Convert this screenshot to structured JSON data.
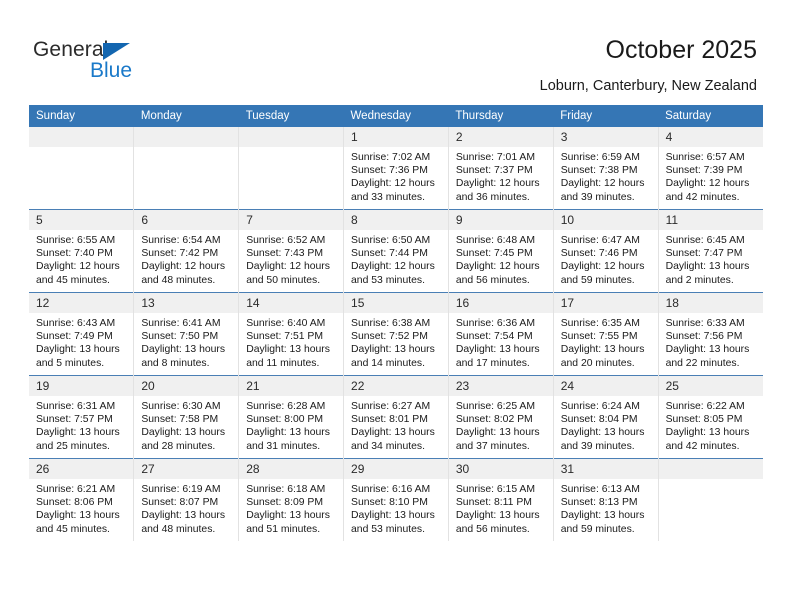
{
  "logo": {
    "word_top": "General",
    "word_bottom": "Blue",
    "triangle_color": "#1366b0",
    "blue_color": "#1a79c9"
  },
  "header": {
    "title": "October 2025",
    "subtitle": "Loburn, Canterbury, New Zealand"
  },
  "theme": {
    "header_bg": "#3576b5",
    "daynum_bg": "#f0f0f0",
    "row_divider": "#4a7fb5",
    "cell_divider": "#e2e2e2"
  },
  "weekdays": [
    "Sunday",
    "Monday",
    "Tuesday",
    "Wednesday",
    "Thursday",
    "Friday",
    "Saturday"
  ],
  "weeks": [
    [
      {
        "day": "",
        "lines": []
      },
      {
        "day": "",
        "lines": []
      },
      {
        "day": "",
        "lines": []
      },
      {
        "day": "1",
        "lines": [
          "Sunrise: 7:02 AM",
          "Sunset: 7:36 PM",
          "Daylight: 12 hours",
          "and 33 minutes."
        ]
      },
      {
        "day": "2",
        "lines": [
          "Sunrise: 7:01 AM",
          "Sunset: 7:37 PM",
          "Daylight: 12 hours",
          "and 36 minutes."
        ]
      },
      {
        "day": "3",
        "lines": [
          "Sunrise: 6:59 AM",
          "Sunset: 7:38 PM",
          "Daylight: 12 hours",
          "and 39 minutes."
        ]
      },
      {
        "day": "4",
        "lines": [
          "Sunrise: 6:57 AM",
          "Sunset: 7:39 PM",
          "Daylight: 12 hours",
          "and 42 minutes."
        ]
      }
    ],
    [
      {
        "day": "5",
        "lines": [
          "Sunrise: 6:55 AM",
          "Sunset: 7:40 PM",
          "Daylight: 12 hours",
          "and 45 minutes."
        ]
      },
      {
        "day": "6",
        "lines": [
          "Sunrise: 6:54 AM",
          "Sunset: 7:42 PM",
          "Daylight: 12 hours",
          "and 48 minutes."
        ]
      },
      {
        "day": "7",
        "lines": [
          "Sunrise: 6:52 AM",
          "Sunset: 7:43 PM",
          "Daylight: 12 hours",
          "and 50 minutes."
        ]
      },
      {
        "day": "8",
        "lines": [
          "Sunrise: 6:50 AM",
          "Sunset: 7:44 PM",
          "Daylight: 12 hours",
          "and 53 minutes."
        ]
      },
      {
        "day": "9",
        "lines": [
          "Sunrise: 6:48 AM",
          "Sunset: 7:45 PM",
          "Daylight: 12 hours",
          "and 56 minutes."
        ]
      },
      {
        "day": "10",
        "lines": [
          "Sunrise: 6:47 AM",
          "Sunset: 7:46 PM",
          "Daylight: 12 hours",
          "and 59 minutes."
        ]
      },
      {
        "day": "11",
        "lines": [
          "Sunrise: 6:45 AM",
          "Sunset: 7:47 PM",
          "Daylight: 13 hours",
          "and 2 minutes."
        ]
      }
    ],
    [
      {
        "day": "12",
        "lines": [
          "Sunrise: 6:43 AM",
          "Sunset: 7:49 PM",
          "Daylight: 13 hours",
          "and 5 minutes."
        ]
      },
      {
        "day": "13",
        "lines": [
          "Sunrise: 6:41 AM",
          "Sunset: 7:50 PM",
          "Daylight: 13 hours",
          "and 8 minutes."
        ]
      },
      {
        "day": "14",
        "lines": [
          "Sunrise: 6:40 AM",
          "Sunset: 7:51 PM",
          "Daylight: 13 hours",
          "and 11 minutes."
        ]
      },
      {
        "day": "15",
        "lines": [
          "Sunrise: 6:38 AM",
          "Sunset: 7:52 PM",
          "Daylight: 13 hours",
          "and 14 minutes."
        ]
      },
      {
        "day": "16",
        "lines": [
          "Sunrise: 6:36 AM",
          "Sunset: 7:54 PM",
          "Daylight: 13 hours",
          "and 17 minutes."
        ]
      },
      {
        "day": "17",
        "lines": [
          "Sunrise: 6:35 AM",
          "Sunset: 7:55 PM",
          "Daylight: 13 hours",
          "and 20 minutes."
        ]
      },
      {
        "day": "18",
        "lines": [
          "Sunrise: 6:33 AM",
          "Sunset: 7:56 PM",
          "Daylight: 13 hours",
          "and 22 minutes."
        ]
      }
    ],
    [
      {
        "day": "19",
        "lines": [
          "Sunrise: 6:31 AM",
          "Sunset: 7:57 PM",
          "Daylight: 13 hours",
          "and 25 minutes."
        ]
      },
      {
        "day": "20",
        "lines": [
          "Sunrise: 6:30 AM",
          "Sunset: 7:58 PM",
          "Daylight: 13 hours",
          "and 28 minutes."
        ]
      },
      {
        "day": "21",
        "lines": [
          "Sunrise: 6:28 AM",
          "Sunset: 8:00 PM",
          "Daylight: 13 hours",
          "and 31 minutes."
        ]
      },
      {
        "day": "22",
        "lines": [
          "Sunrise: 6:27 AM",
          "Sunset: 8:01 PM",
          "Daylight: 13 hours",
          "and 34 minutes."
        ]
      },
      {
        "day": "23",
        "lines": [
          "Sunrise: 6:25 AM",
          "Sunset: 8:02 PM",
          "Daylight: 13 hours",
          "and 37 minutes."
        ]
      },
      {
        "day": "24",
        "lines": [
          "Sunrise: 6:24 AM",
          "Sunset: 8:04 PM",
          "Daylight: 13 hours",
          "and 39 minutes."
        ]
      },
      {
        "day": "25",
        "lines": [
          "Sunrise: 6:22 AM",
          "Sunset: 8:05 PM",
          "Daylight: 13 hours",
          "and 42 minutes."
        ]
      }
    ],
    [
      {
        "day": "26",
        "lines": [
          "Sunrise: 6:21 AM",
          "Sunset: 8:06 PM",
          "Daylight: 13 hours",
          "and 45 minutes."
        ]
      },
      {
        "day": "27",
        "lines": [
          "Sunrise: 6:19 AM",
          "Sunset: 8:07 PM",
          "Daylight: 13 hours",
          "and 48 minutes."
        ]
      },
      {
        "day": "28",
        "lines": [
          "Sunrise: 6:18 AM",
          "Sunset: 8:09 PM",
          "Daylight: 13 hours",
          "and 51 minutes."
        ]
      },
      {
        "day": "29",
        "lines": [
          "Sunrise: 6:16 AM",
          "Sunset: 8:10 PM",
          "Daylight: 13 hours",
          "and 53 minutes."
        ]
      },
      {
        "day": "30",
        "lines": [
          "Sunrise: 6:15 AM",
          "Sunset: 8:11 PM",
          "Daylight: 13 hours",
          "and 56 minutes."
        ]
      },
      {
        "day": "31",
        "lines": [
          "Sunrise: 6:13 AM",
          "Sunset: 8:13 PM",
          "Daylight: 13 hours",
          "and 59 minutes."
        ]
      },
      {
        "day": "",
        "lines": []
      }
    ]
  ]
}
